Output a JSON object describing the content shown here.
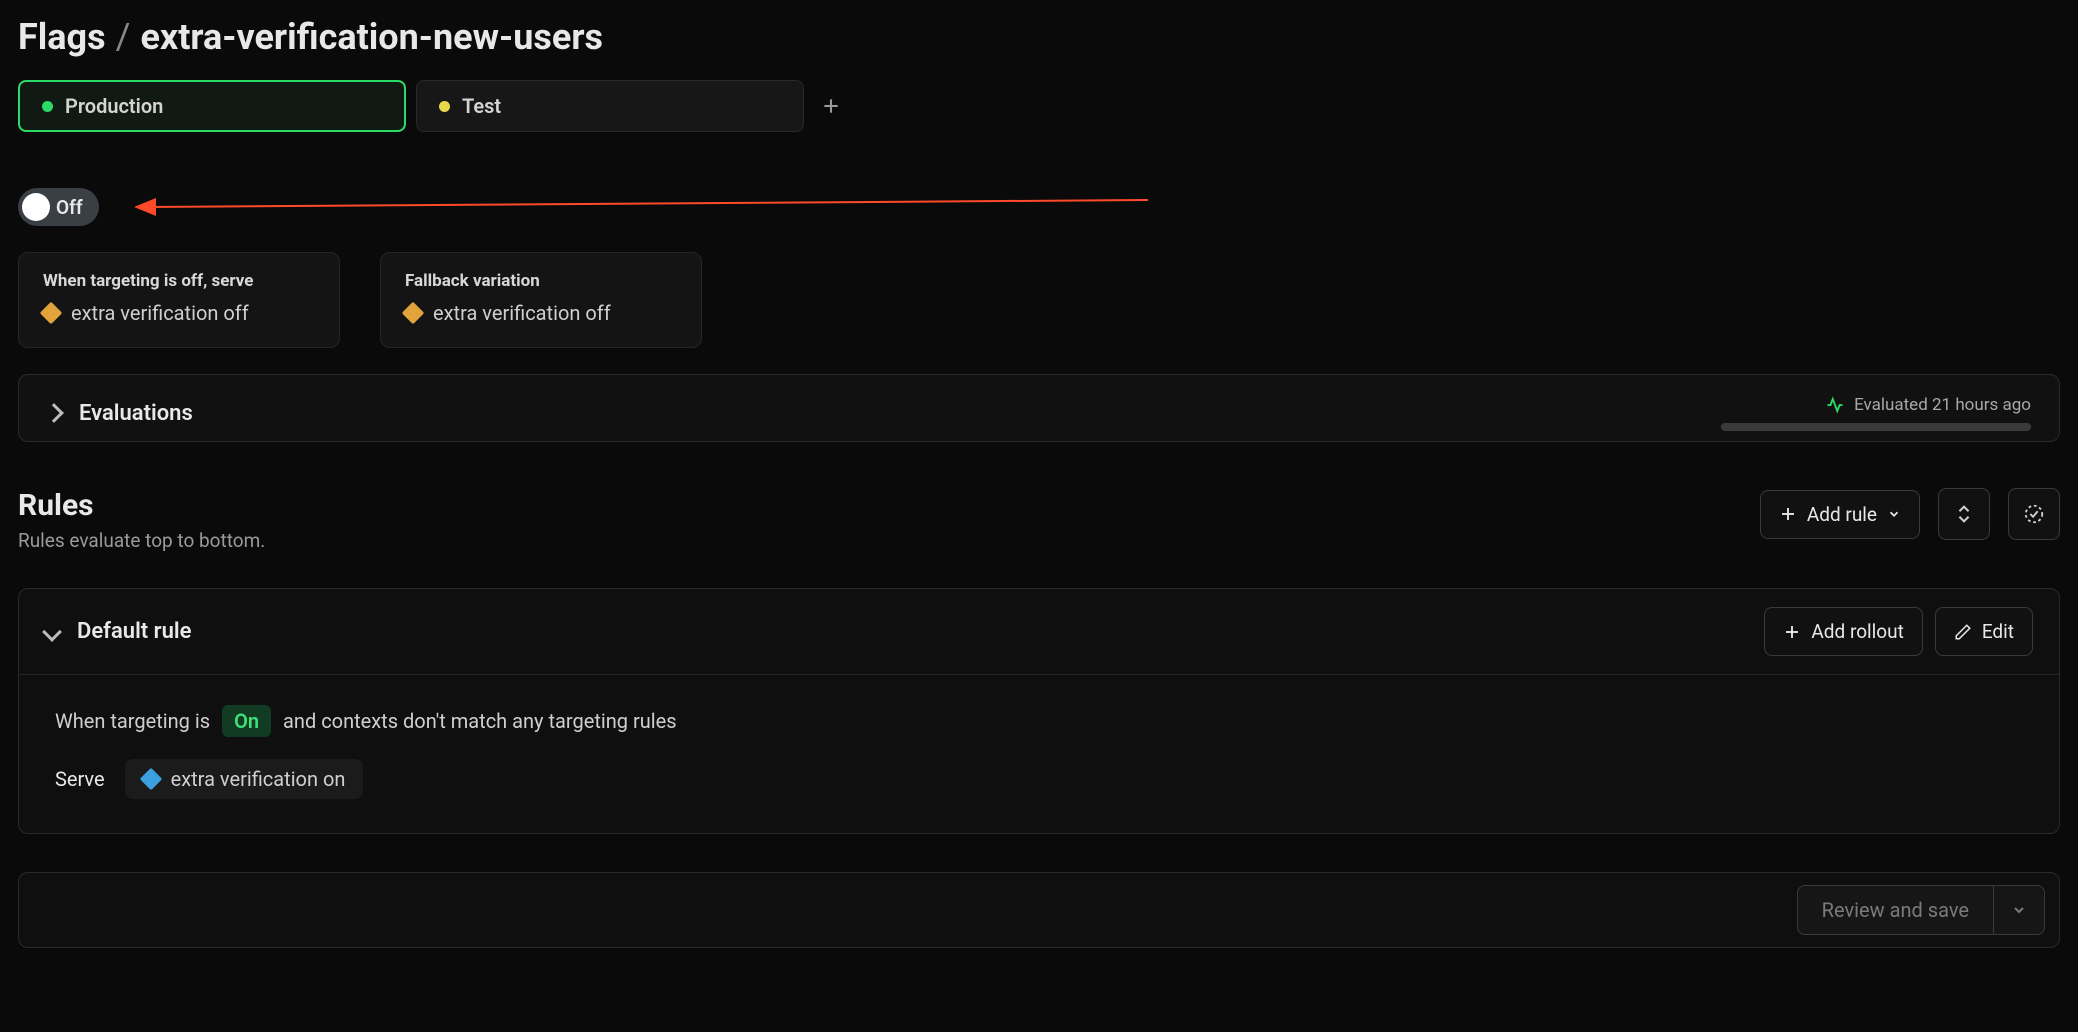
{
  "breadcrumb": {
    "root": "Flags",
    "sep": "/",
    "leaf": "extra-verification-new-users"
  },
  "envs": {
    "items": [
      {
        "label": "Production",
        "color": "green",
        "active": true
      },
      {
        "label": "Test",
        "color": "yellow",
        "active": false
      }
    ]
  },
  "toggle": {
    "label": "Off"
  },
  "cards": {
    "off_serve": {
      "title": "When targeting is off, serve",
      "variation": "extra verification off"
    },
    "fallback": {
      "title": "Fallback variation",
      "variation": "extra verification off"
    }
  },
  "evaluations": {
    "title": "Evaluations",
    "last": "Evaluated 21 hours ago"
  },
  "rules": {
    "title": "Rules",
    "subtitle": "Rules evaluate top to bottom.",
    "add_rule_label": "Add rule"
  },
  "default_rule": {
    "title": "Default rule",
    "add_rollout_label": "Add rollout",
    "edit_label": "Edit",
    "line_prefix": "When targeting is",
    "on_badge": "On",
    "line_suffix": "and contexts don't match any targeting rules",
    "serve_label": "Serve",
    "serve_value": "extra verification on"
  },
  "save": {
    "label": "Review and save"
  }
}
